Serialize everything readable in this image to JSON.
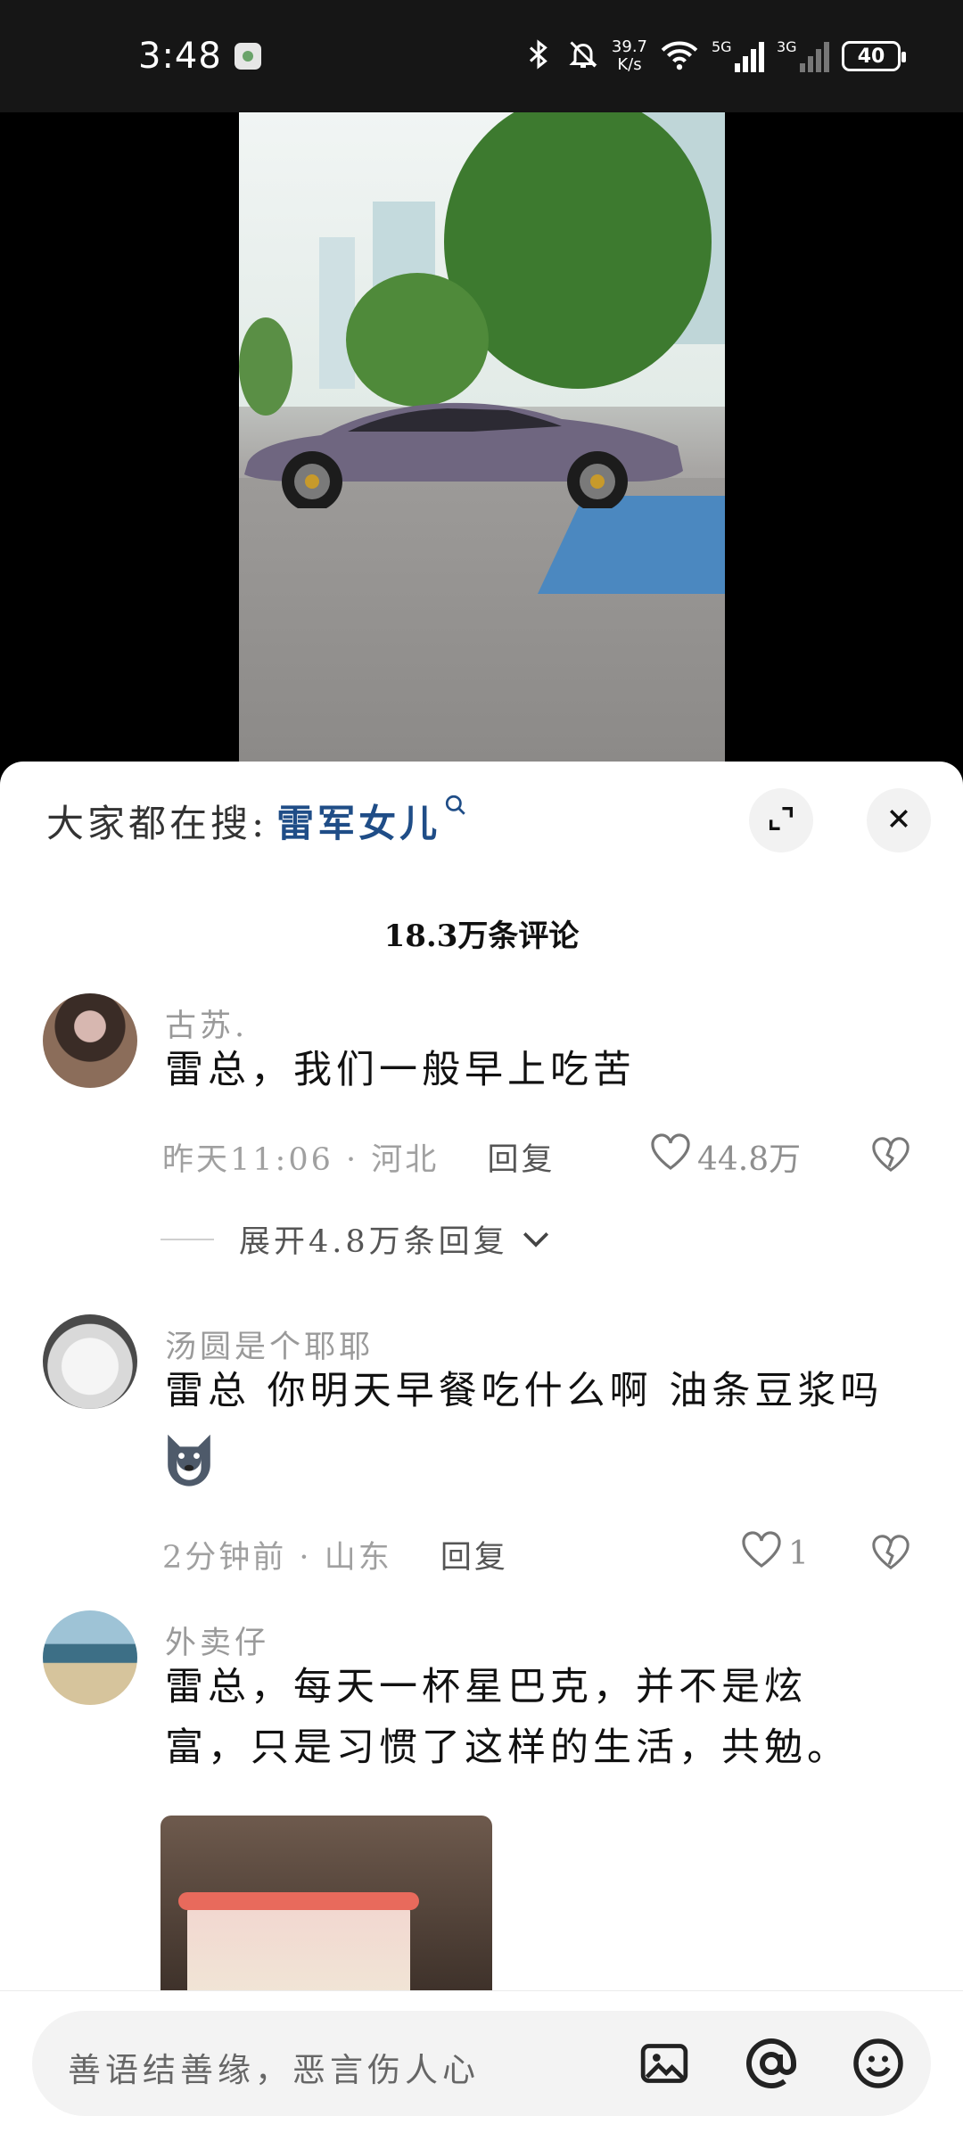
{
  "status_bar": {
    "time": "3:48",
    "net_speed_value": "39.7",
    "net_speed_unit": "K/s",
    "sim1_label": "5G",
    "sim2_label": "3G",
    "battery": "40"
  },
  "search_suggest": {
    "prefix": "大家都在搜:",
    "keyword": "雷军女儿",
    "icon": "search-icon"
  },
  "header": {
    "comment_count": "18.3万条评论",
    "expand_icon": "expand-icon",
    "close_icon": "close-icon"
  },
  "comments": [
    {
      "username": "古苏.",
      "text": "雷总，我们一般早上吃苦",
      "time": "昨天11:06",
      "location": "河北",
      "reply_label": "回复",
      "likes": "44.8万",
      "expand_replies": "展开4.8万条回复"
    },
    {
      "username": "汤圆是个耶耶",
      "text": "雷总 你明天早餐吃什么啊 油条豆浆吗",
      "time": "2分钟前",
      "location": "山东",
      "reply_label": "回复",
      "likes": "1"
    },
    {
      "username": "外卖仔",
      "text": "雷总，每天一杯星巴克，并不是炫富，只是习惯了这样的生活，共勉。"
    }
  ],
  "input_bar": {
    "placeholder": "善语结善缘，恶言伤人心",
    "icons": [
      "image-icon",
      "at-icon",
      "emoji-icon"
    ]
  },
  "colors": {
    "search_keyword": "#1f4d87",
    "status_bar_bg": "#161616",
    "meta_text": "#a0a0a0"
  }
}
